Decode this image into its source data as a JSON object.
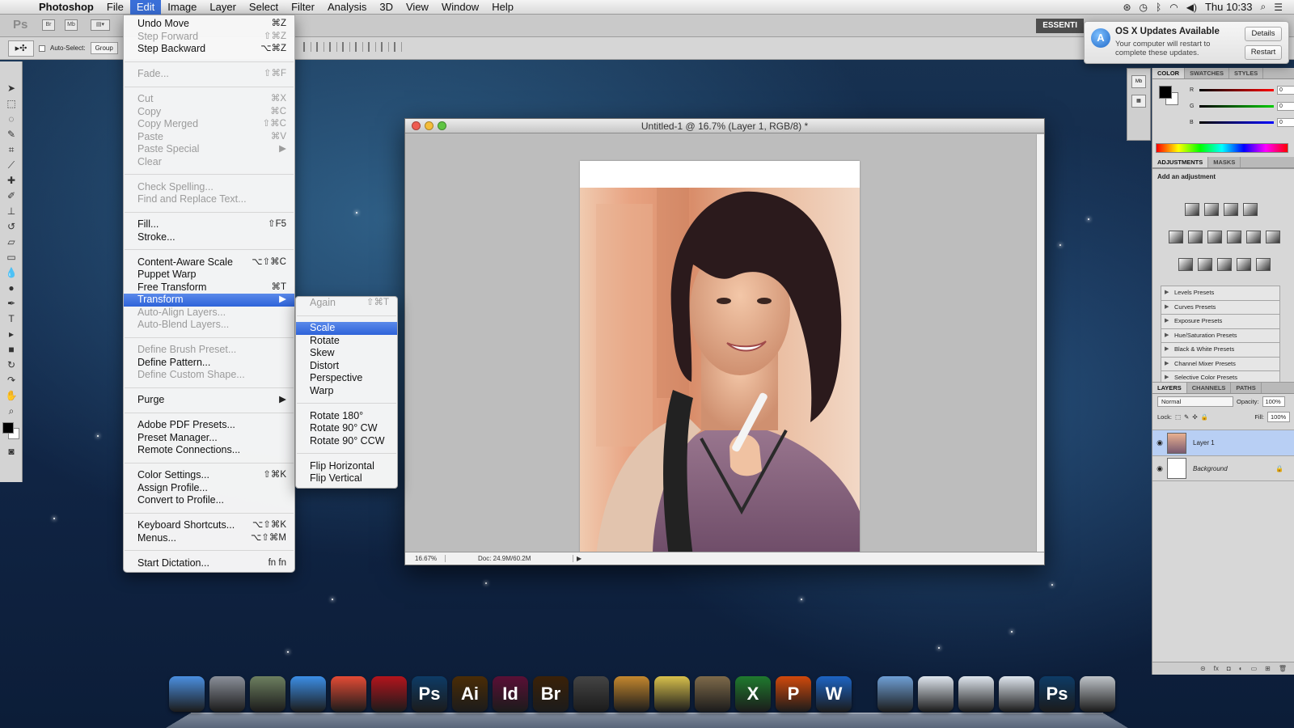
{
  "menubar": {
    "apple": "",
    "items": [
      "Photoshop",
      "File",
      "Edit",
      "Image",
      "Layer",
      "Select",
      "Filter",
      "Analysis",
      "3D",
      "View",
      "Window",
      "Help"
    ],
    "active": "Edit",
    "clock": "Thu 10:33"
  },
  "appbar": {
    "ps_logo": "Ps",
    "br": "Br",
    "mb": "Mb",
    "essentials": "ESSENTI"
  },
  "options": {
    "auto_select_label": "Auto-Select:",
    "group_label": "Group"
  },
  "notification": {
    "title": "OS X Updates Available",
    "body": "Your computer will restart to complete these updates.",
    "details": "Details",
    "restart": "Restart"
  },
  "edit_menu": [
    {
      "label": "Undo Move",
      "sc": "⌘Z",
      "dis": false
    },
    {
      "label": "Step Forward",
      "sc": "⇧⌘Z",
      "dis": true
    },
    {
      "label": "Step Backward",
      "sc": "⌥⌘Z",
      "dis": false
    },
    {
      "sep": true
    },
    {
      "label": "Fade...",
      "sc": "⇧⌘F",
      "dis": true
    },
    {
      "sep": true
    },
    {
      "label": "Cut",
      "sc": "⌘X",
      "dis": true
    },
    {
      "label": "Copy",
      "sc": "⌘C",
      "dis": true
    },
    {
      "label": "Copy Merged",
      "sc": "⇧⌘C",
      "dis": true
    },
    {
      "label": "Paste",
      "sc": "⌘V",
      "dis": true
    },
    {
      "label": "Paste Special",
      "sc": "▶",
      "dis": true
    },
    {
      "label": "Clear",
      "sc": "",
      "dis": true
    },
    {
      "sep": true
    },
    {
      "label": "Check Spelling...",
      "sc": "",
      "dis": true
    },
    {
      "label": "Find and Replace Text...",
      "sc": "",
      "dis": true
    },
    {
      "sep": true
    },
    {
      "label": "Fill...",
      "sc": "⇧F5",
      "dis": false
    },
    {
      "label": "Stroke...",
      "sc": "",
      "dis": false
    },
    {
      "sep": true
    },
    {
      "label": "Content-Aware Scale",
      "sc": "⌥⇧⌘C",
      "dis": false
    },
    {
      "label": "Puppet Warp",
      "sc": "",
      "dis": false
    },
    {
      "label": "Free Transform",
      "sc": "⌘T",
      "dis": false
    },
    {
      "label": "Transform",
      "sc": "▶",
      "dis": false,
      "hl": true
    },
    {
      "label": "Auto-Align Layers...",
      "sc": "",
      "dis": true
    },
    {
      "label": "Auto-Blend Layers...",
      "sc": "",
      "dis": true
    },
    {
      "sep": true
    },
    {
      "label": "Define Brush Preset...",
      "sc": "",
      "dis": true
    },
    {
      "label": "Define Pattern...",
      "sc": "",
      "dis": false
    },
    {
      "label": "Define Custom Shape...",
      "sc": "",
      "dis": true
    },
    {
      "sep": true
    },
    {
      "label": "Purge",
      "sc": "▶",
      "dis": false
    },
    {
      "sep": true
    },
    {
      "label": "Adobe PDF Presets...",
      "sc": "",
      "dis": false
    },
    {
      "label": "Preset Manager...",
      "sc": "",
      "dis": false
    },
    {
      "label": "Remote Connections...",
      "sc": "",
      "dis": false
    },
    {
      "sep": true
    },
    {
      "label": "Color Settings...",
      "sc": "⇧⌘K",
      "dis": false
    },
    {
      "label": "Assign Profile...",
      "sc": "",
      "dis": false
    },
    {
      "label": "Convert to Profile...",
      "sc": "",
      "dis": false
    },
    {
      "sep": true
    },
    {
      "label": "Keyboard Shortcuts...",
      "sc": "⌥⇧⌘K",
      "dis": false
    },
    {
      "label": "Menus...",
      "sc": "⌥⇧⌘M",
      "dis": false
    },
    {
      "sep": true
    },
    {
      "label": "Start Dictation...",
      "sc": "fn fn",
      "dis": false
    }
  ],
  "transform_menu": [
    {
      "label": "Again",
      "sc": "⇧⌘T",
      "dis": true
    },
    {
      "sep": true
    },
    {
      "label": "Scale",
      "sc": "",
      "dis": false,
      "hl": true
    },
    {
      "label": "Rotate",
      "sc": "",
      "dis": false
    },
    {
      "label": "Skew",
      "sc": "",
      "dis": false
    },
    {
      "label": "Distort",
      "sc": "",
      "dis": false
    },
    {
      "label": "Perspective",
      "sc": "",
      "dis": false
    },
    {
      "label": "Warp",
      "sc": "",
      "dis": false
    },
    {
      "sep": true
    },
    {
      "label": "Rotate 180°",
      "sc": "",
      "dis": false
    },
    {
      "label": "Rotate 90° CW",
      "sc": "",
      "dis": false
    },
    {
      "label": "Rotate 90° CCW",
      "sc": "",
      "dis": false
    },
    {
      "sep": true
    },
    {
      "label": "Flip Horizontal",
      "sc": "",
      "dis": false
    },
    {
      "label": "Flip Vertical",
      "sc": "",
      "dis": false
    }
  ],
  "document": {
    "title": "Untitled-1 @ 16.7% (Layer 1, RGB/8) *",
    "zoom": "16.67%",
    "doc_size": "Doc: 24.9M/60.2M"
  },
  "color_panel": {
    "tabs": [
      "COLOR",
      "SWATCHES",
      "STYLES"
    ],
    "r": {
      "label": "R",
      "value": "0"
    },
    "g": {
      "label": "G",
      "value": "0"
    },
    "b": {
      "label": "B",
      "value": "0"
    }
  },
  "adjustments": {
    "tabs": [
      "ADJUSTMENTS",
      "MASKS"
    ],
    "title": "Add an adjustment",
    "presets": [
      "Levels Presets",
      "Curves Presets",
      "Exposure Presets",
      "Hue/Saturation Presets",
      "Black & White Presets",
      "Channel Mixer Presets",
      "Selective Color Presets"
    ]
  },
  "layers": {
    "tabs": [
      "LAYERS",
      "CHANNELS",
      "PATHS"
    ],
    "blend_mode": "Normal",
    "opacity_label": "Opacity:",
    "opacity": "100%",
    "lock_label": "Lock:",
    "fill_label": "Fill:",
    "fill": "100%",
    "items": [
      {
        "name": "Layer 1",
        "selected": true
      },
      {
        "name": "Background",
        "selected": false
      }
    ]
  },
  "dock": {
    "apps": [
      {
        "name": "finder-icon",
        "label": "",
        "color": "#4b8fe0"
      },
      {
        "name": "launchpad-icon",
        "label": "",
        "color": "#8a8f99"
      },
      {
        "name": "image-capture-icon",
        "label": "",
        "color": "#6d7f60"
      },
      {
        "name": "safari-icon",
        "label": "",
        "color": "#3c8ee6"
      },
      {
        "name": "chrome-icon",
        "label": "",
        "color": "#e44b35"
      },
      {
        "name": "photo-booth-icon",
        "label": "",
        "color": "#b3141c"
      },
      {
        "name": "photoshop-icon",
        "label": "Ps",
        "color": "#0d3b66"
      },
      {
        "name": "illustrator-icon",
        "label": "Ai",
        "color": "#4a2c06"
      },
      {
        "name": "indesign-icon",
        "label": "Id",
        "color": "#5a0f36"
      },
      {
        "name": "bridge-icon",
        "label": "Br",
        "color": "#3a2108"
      },
      {
        "name": "final-cut-icon",
        "label": "",
        "color": "#444444"
      },
      {
        "name": "garageband-icon",
        "label": "",
        "color": "#c4872e"
      },
      {
        "name": "imovie-icon",
        "label": "",
        "color": "#d8c04c"
      },
      {
        "name": "iphoto-icon",
        "label": "",
        "color": "#7e6a4a"
      },
      {
        "name": "excel-icon",
        "label": "X",
        "color": "#1f7a2e"
      },
      {
        "name": "powerpoint-icon",
        "label": "P",
        "color": "#d1490b"
      },
      {
        "name": "word-icon",
        "label": "W",
        "color": "#1d64c4"
      }
    ],
    "right": [
      {
        "name": "applications-folder-icon",
        "label": "",
        "color": "#6f9fd6"
      },
      {
        "name": "stack-icon-1",
        "label": "",
        "color": "#dfe6ee"
      },
      {
        "name": "stack-icon-2",
        "label": "",
        "color": "#dfe6ee"
      },
      {
        "name": "stack-icon-3",
        "label": "",
        "color": "#dfe6ee"
      },
      {
        "name": "photo-file-icon",
        "label": "Ps",
        "color": "#0d3b66"
      },
      {
        "name": "trash-icon",
        "label": "",
        "color": "#bfc4c9"
      }
    ]
  }
}
